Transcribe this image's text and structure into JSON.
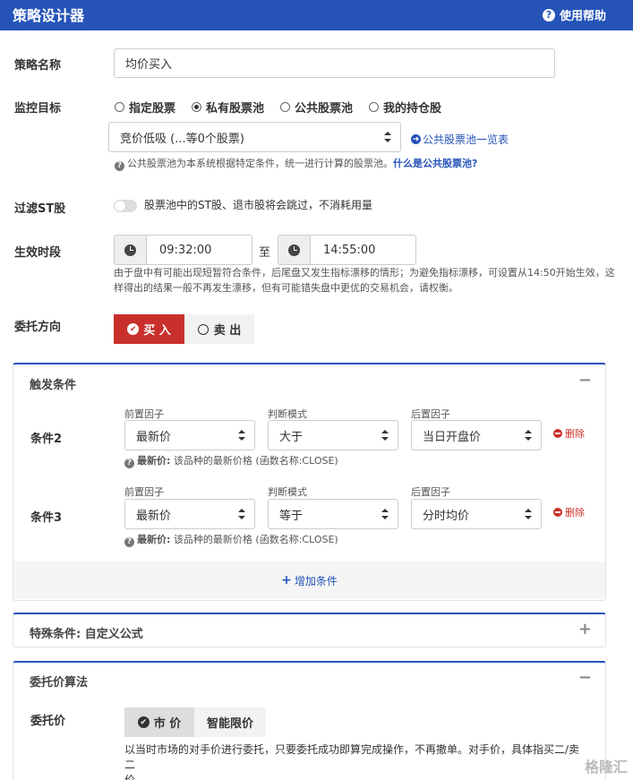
{
  "header": {
    "title": "策略设计器",
    "help": "使用帮助"
  },
  "strategy_name": {
    "label": "策略名称",
    "value": "均价买入"
  },
  "monitor": {
    "label": "监控目标",
    "options": [
      "指定股票",
      "私有股票池",
      "公共股票池",
      "我的持仓股"
    ],
    "selected": "私有股票池",
    "pool_select": "竞价低吸 (...等0个股票)",
    "pool_link": "公共股票池一览表",
    "hint": "公共股票池为本系统根据特定条件，统一进行计算的股票池。",
    "hint_link": "什么是公共股票池?"
  },
  "filter_st": {
    "label": "过滤ST股",
    "text": "股票池中的ST股、退市股将会跳过，不消耗用量",
    "enabled": false
  },
  "active_period": {
    "label": "生效时段",
    "start": "09:32:00",
    "to": "至",
    "end": "14:55:00",
    "note_line1": "由于盘中有可能出现短暂符合条件，后尾盘又发生指标漂移的情形；为避免指标漂移，可设置从14:50开始生效，这",
    "note_line2": "样得出的结果一般不再发生漂移，但有可能错失盘中更优的交易机会，请权衡。"
  },
  "direction": {
    "label": "委托方向",
    "buy": "买 入",
    "sell": "卖 出",
    "selected": "buy"
  },
  "trigger_panel": {
    "title": "触发条件",
    "toggle": "−",
    "col_front": "前置因子",
    "col_mode": "判断模式",
    "col_back": "后置因子",
    "delete": "删除",
    "conditions": [
      {
        "label": "条件2",
        "front": "最新价",
        "mode": "大于",
        "back": "当日开盘价",
        "hint_bold": "最新价:",
        "hint": "该品种的最新价格 (函数名称:CLOSE)"
      },
      {
        "label": "条件3",
        "front": "最新价",
        "mode": "等于",
        "back": "分时均价",
        "hint_bold": "最新价:",
        "hint": "该品种的最新价格 (函数名称:CLOSE)"
      }
    ],
    "add": "增加条件"
  },
  "special_panel": {
    "title": "特殊条件: 自定义公式",
    "toggle": "+"
  },
  "price_panel": {
    "title": "委托价算法",
    "toggle": "−",
    "label": "委托价",
    "market": "市 价",
    "smart": "智能限价",
    "desc_line1": "以当时市场的对手价进行委托，只要委托成功即算完成操作，不再撤单。对手价，具体指买二/卖二",
    "desc_line2": "价。"
  },
  "watermark": "格隆汇",
  "colors": {
    "primary": "#2553b8",
    "danger": "#c9302c"
  }
}
